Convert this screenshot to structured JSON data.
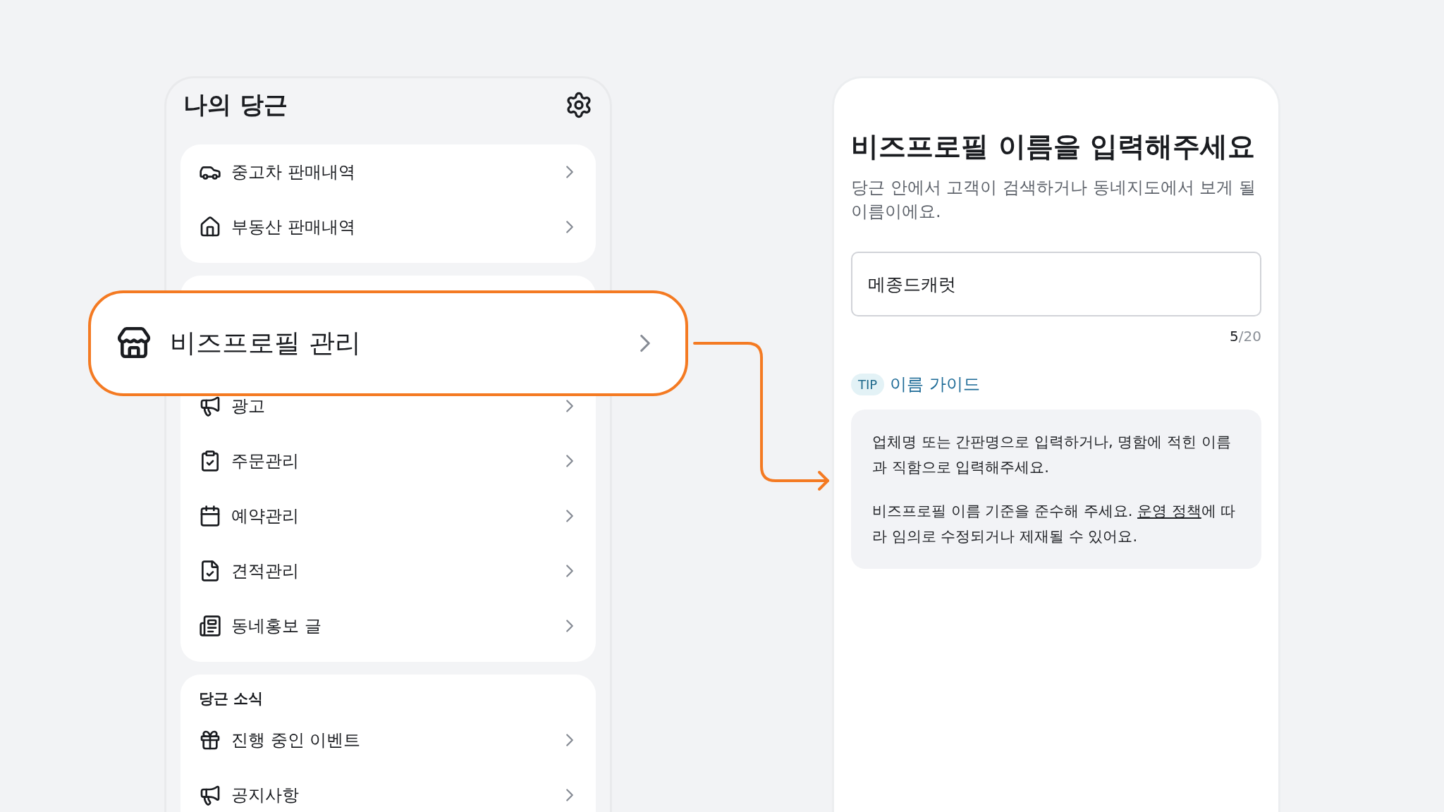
{
  "header": {
    "title": "나의 당근"
  },
  "sections": [
    {
      "items": [
        {
          "label": "중고차 판매내역"
        },
        {
          "label": "부동산 판매내역"
        }
      ]
    },
    {
      "items": [
        {
          "label": "광고"
        },
        {
          "label": "주문관리"
        },
        {
          "label": "예약관리"
        },
        {
          "label": "견적관리"
        },
        {
          "label": "동네홍보 글"
        }
      ]
    },
    {
      "title": "당근 소식",
      "items": [
        {
          "label": "진행 중인 이벤트"
        },
        {
          "label": "공지사항"
        }
      ]
    }
  ],
  "highlight": {
    "label": "비즈프로필 관리"
  },
  "form": {
    "title": "비즈프로필 이름을 입력해주세요",
    "description": "당근 안에서 고객이 검색하거나 동네지도에서 보게 될 이름이에요.",
    "input_value": "메종드캐럿",
    "count": "5",
    "max": "/20",
    "tip_badge": "TIP",
    "tip_title": "이름 가이드",
    "guide": [
      {
        "text": "업체명 또는 간판명으로 입력하거나, 명함에 적힌 이름과 직함으로 입력해주세요."
      },
      {
        "text": "비즈프로필 이름 기준을 준수해 주세요. ",
        "link": "운영 정책",
        "after": "에 따라 임의로 수정되거나 제재될 수 있어요."
      }
    ]
  }
}
